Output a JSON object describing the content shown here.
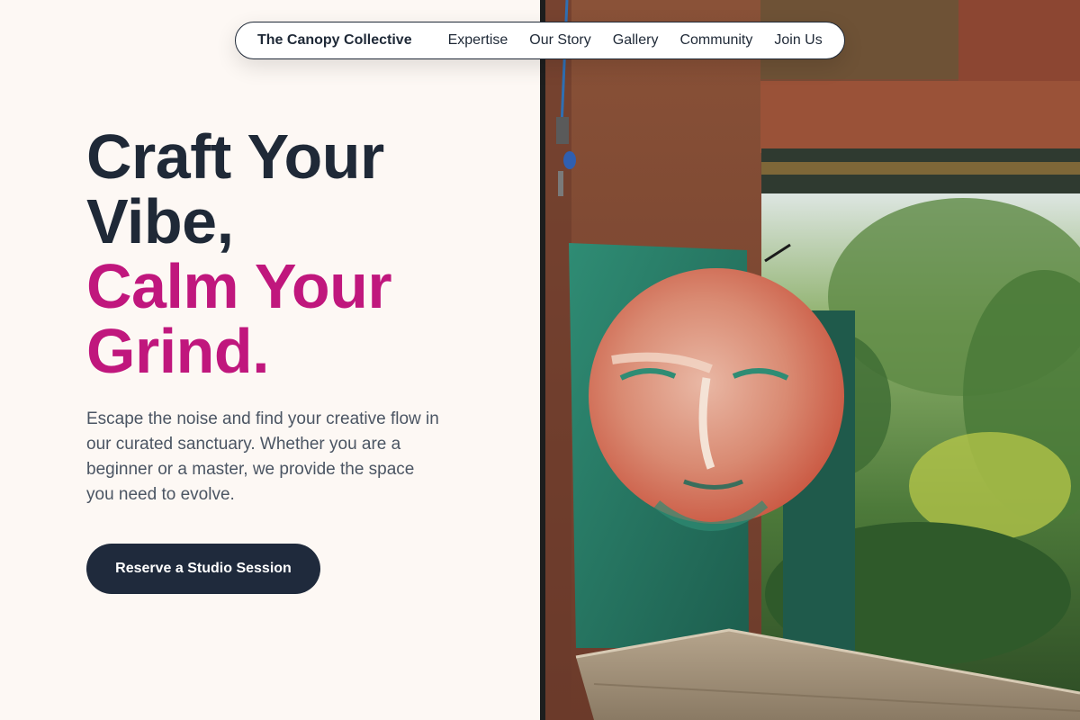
{
  "nav": {
    "brand": "The Canopy Collective",
    "links": [
      "Expertise",
      "Our Story",
      "Gallery",
      "Community",
      "Join Us"
    ]
  },
  "hero": {
    "title_line1": "Craft Your",
    "title_line2": "Vibe,",
    "title_line3": "Calm Your",
    "title_line4": "Grind.",
    "description": "Escape the noise and find your creative flow in our curated sanctuary. Whether you are a beginner or a master, we provide the space you need to evolve.",
    "cta_label": "Reserve a Studio Session"
  },
  "colors": {
    "dark": "#1f2937",
    "accent": "#c0177d",
    "background": "#fdf8f4",
    "button": "#1f2a3c"
  },
  "image": {
    "subject": "painted-face-artwork-in-rusted-pavilion"
  }
}
